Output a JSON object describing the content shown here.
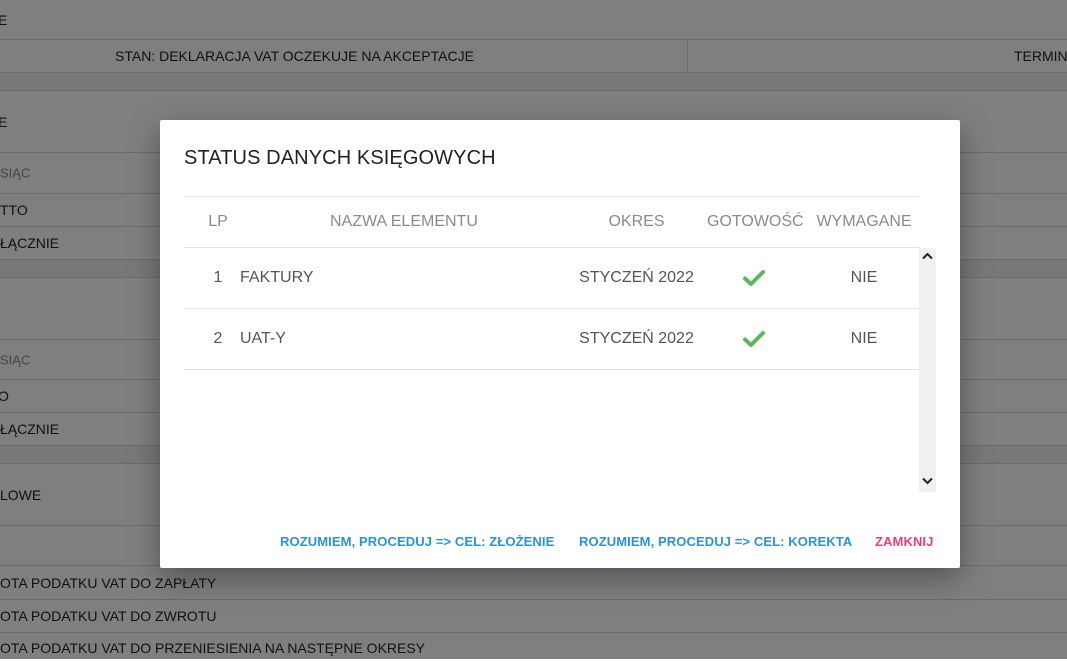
{
  "background": {
    "top_fragment": "E",
    "stan_text": "STAN: DEKLARACJA VAT OCZEKUJE NA AKCEPTACJE",
    "termin_text": "TERMIN",
    "section1_title": "E",
    "section1_header": "SIĄC",
    "section1_row1": "TTO",
    "section1_row2": "ŁĄCZNIE",
    "section2_header": "SIĄC",
    "section2_row1": "O",
    "section2_row2": "ŁĄCZNIE",
    "section3_title": "LOWE",
    "tax_rows": [
      "OTA PODATKU VAT DO ZAPŁATY",
      "OTA PODATKU VAT DO ZWROTU",
      "OTA PODATKU VAT DO PRZENIESIENIA NA NASTĘPNE OKRESY"
    ]
  },
  "modal": {
    "title": "STATUS DANYCH KSIĘGOWYCH",
    "columns": {
      "lp": "LP",
      "name": "NAZWA ELEMENTU",
      "okres": "OKRES",
      "gotowosc": "GOTOWOŚĆ",
      "wymagane": "WYMAGANE"
    },
    "rows": [
      {
        "lp": "1",
        "name": "FAKTURY",
        "okres": "STYCZEŃ 2022",
        "gotowosc": "check-icon",
        "wymagane": "NIE"
      },
      {
        "lp": "2",
        "name": "UAT-Y",
        "okres": "STYCZEŃ 2022",
        "gotowosc": "check-icon",
        "wymagane": "NIE"
      }
    ],
    "buttons": {
      "proceed_submit": "ROZUMIEM, PROCEDUJ => CEL: ZŁOŻENIE",
      "proceed_correction": "ROZUMIEM, PROCEDUJ => CEL: KOREKTA",
      "close": "ZAMKNIJ"
    }
  },
  "colors": {
    "primary": "#2a93d5",
    "danger": "#e8407a",
    "success": "#5cb85c"
  }
}
